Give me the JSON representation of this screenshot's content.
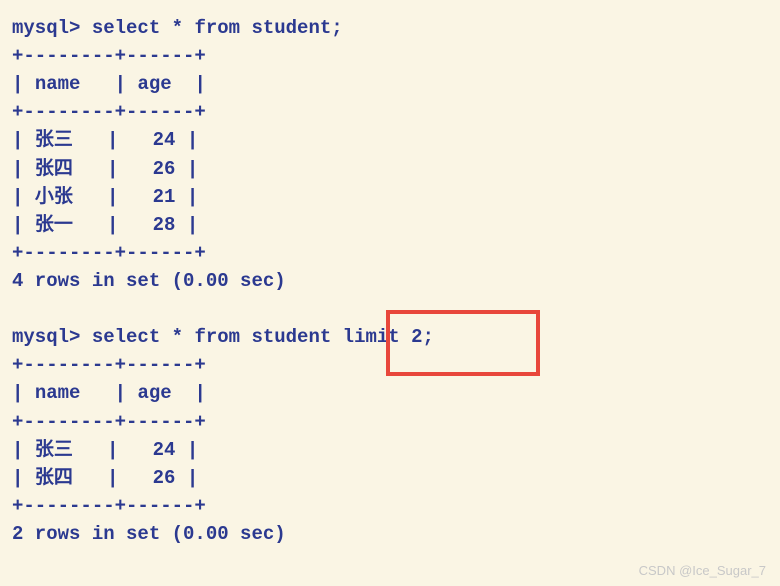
{
  "query1": {
    "prompt": "mysql> ",
    "sql": "select * from student;",
    "headers": {
      "name": "name",
      "age": "age"
    },
    "rows": [
      {
        "name": "张三",
        "age": "24"
      },
      {
        "name": "张四",
        "age": "26"
      },
      {
        "name": "小张",
        "age": "21"
      },
      {
        "name": "张一",
        "age": "28"
      }
    ],
    "status": "4 rows in set (0.00 sec)"
  },
  "query2": {
    "prompt": "mysql> ",
    "sql_before": "select * from student",
    "sql_limit": " limit 2;",
    "headers": {
      "name": "name",
      "age": "age"
    },
    "rows": [
      {
        "name": "张三",
        "age": "24"
      },
      {
        "name": "张四",
        "age": "26"
      }
    ],
    "status": "2 rows in set (0.00 sec)"
  },
  "border": {
    "hr": "+--------+------+",
    "head_open": "| ",
    "head_sep": "   | ",
    "head_close": "  |",
    "row_open": "| ",
    "row_sep": "   |   ",
    "row_close": " |"
  },
  "watermark": "CSDN @Ice_Sugar_7",
  "highlight": {
    "left": "386",
    "top": "310",
    "width": "154",
    "height": "66"
  }
}
